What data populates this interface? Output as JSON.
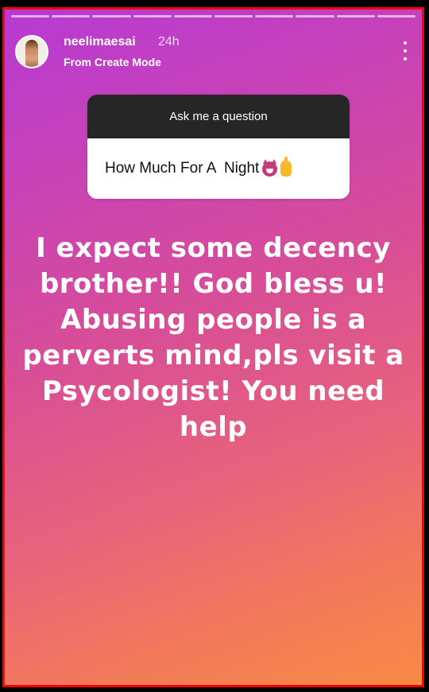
{
  "story": {
    "username": "neelimaesai",
    "time": "24h",
    "subtitle": "From Create Mode",
    "progress_segments": 10
  },
  "question_sticker": {
    "header": "Ask me a question",
    "question": "How Much For A  Night",
    "emoji_icons": [
      "devil-tongue-emoji-icon",
      "pointing-up-emoji-icon"
    ]
  },
  "caption": "I expect some decency brother!! God bless u! Abusing people is a perverts mind,pls visit a Psycologist! You need help",
  "colors": {
    "gradient_start": "#b63ad4",
    "gradient_end": "#f98a45",
    "border": "#ff0000",
    "sticker_header": "#262626"
  }
}
